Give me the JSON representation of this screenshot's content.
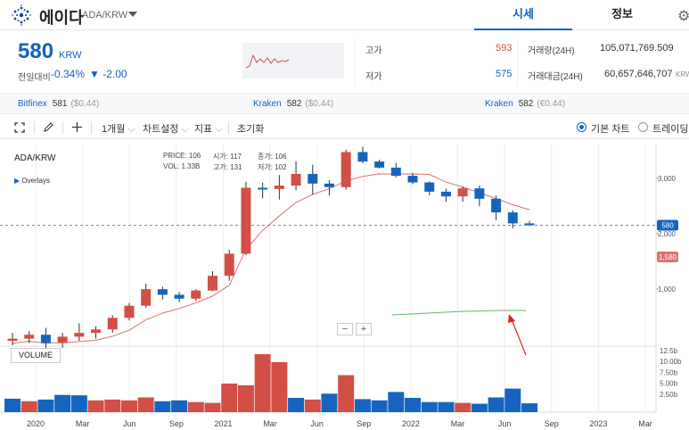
{
  "header": {
    "coin_name": "에이다",
    "pair": "ADA/KRW",
    "tabs": [
      "시세",
      "정보"
    ],
    "settings_icon": "gear-icon"
  },
  "price": {
    "current": "580",
    "unit": "KRW",
    "change_label": "전일대비",
    "change_pct": "-0.34%",
    "change_abs": "▼ -2.00"
  },
  "stats": {
    "high_label": "고가",
    "high": "593",
    "low_label": "저가",
    "low": "575",
    "volume_label": "거래량(24H)",
    "volume": "105,071,769.509",
    "value_label": "거래대금(24H)",
    "value": "60,657,646,707",
    "value_unit": "KRW"
  },
  "exchanges": [
    {
      "name": "Bitfinex",
      "price": "581",
      "sub": "($0.44)"
    },
    {
      "name": "Kraken",
      "price": "582",
      "sub": "($0.44)"
    },
    {
      "name": "Kraken",
      "price": "582",
      "sub": "(€0.44)"
    }
  ],
  "toolbar": {
    "period": "1개월",
    "chart_settings": "차트설정",
    "indicators": "지표",
    "reset": "초기화",
    "basic_chart": "기본 차트",
    "trading_chart": "트레이딩뷰"
  },
  "ohlc_box": {
    "symbol": "ADA/KRW",
    "price_label": "PRICE:",
    "price": "106",
    "open_label": "시가:",
    "open": "117",
    "close_label": "종가:",
    "close": "106",
    "vol_label": "VOL:",
    "vol": "1.33B",
    "high_label": "고가:",
    "high": "131",
    "low_label": "저가:",
    "low": "102",
    "overlays": "Overlays",
    "volume_button": "VOLUME"
  },
  "chart_data": {
    "type": "candlestick",
    "price_axis_labels": [
      "3,000",
      "2,000",
      "1,000"
    ],
    "volume_axis_labels": [
      "12.5b",
      "10.00b",
      "7.50b",
      "5.00b",
      "2.50b"
    ],
    "x_ticks": [
      "2020",
      "Mar",
      "Jun",
      "Sep",
      "2021",
      "Mar",
      "Jun",
      "Sep",
      "2022",
      "Mar",
      "Jun",
      "Sep",
      "2023",
      "Mar"
    ],
    "ma_badge": "1,580",
    "last_badge": "580",
    "colors": {
      "up": "#d24f45",
      "down": "#1565c0",
      "ma_red": "#e07070",
      "ma_green": "#5fb85f"
    },
    "candles": [
      {
        "o": 40,
        "h": 48,
        "l": 36,
        "c": 42
      },
      {
        "o": 42,
        "h": 50,
        "l": 38,
        "c": 46
      },
      {
        "o": 46,
        "h": 54,
        "l": 32,
        "c": 38
      },
      {
        "o": 38,
        "h": 48,
        "l": 34,
        "c": 44
      },
      {
        "o": 44,
        "h": 60,
        "l": 40,
        "c": 48
      },
      {
        "o": 48,
        "h": 56,
        "l": 42,
        "c": 52
      },
      {
        "o": 52,
        "h": 72,
        "l": 48,
        "c": 68
      },
      {
        "o": 68,
        "h": 96,
        "l": 64,
        "c": 90
      },
      {
        "o": 90,
        "h": 150,
        "l": 86,
        "c": 132
      },
      {
        "o": 132,
        "h": 140,
        "l": 104,
        "c": 116
      },
      {
        "o": 116,
        "h": 124,
        "l": 98,
        "c": 106
      },
      {
        "o": 106,
        "h": 132,
        "l": 100,
        "c": 128
      },
      {
        "o": 128,
        "h": 200,
        "l": 126,
        "c": 180
      },
      {
        "o": 180,
        "h": 330,
        "l": 160,
        "c": 300
      },
      {
        "o": 300,
        "h": 1580,
        "l": 290,
        "c": 1380
      },
      {
        "o": 1380,
        "h": 1560,
        "l": 1080,
        "c": 1340
      },
      {
        "o": 1340,
        "h": 1850,
        "l": 1050,
        "c": 1450
      },
      {
        "o": 1450,
        "h": 2550,
        "l": 1300,
        "c": 1900
      },
      {
        "o": 1900,
        "h": 2350,
        "l": 1180,
        "c": 1520
      },
      {
        "o": 1520,
        "h": 1640,
        "l": 1150,
        "c": 1400
      },
      {
        "o": 1400,
        "h": 3330,
        "l": 1320,
        "c": 3150
      },
      {
        "o": 3150,
        "h": 3560,
        "l": 2440,
        "c": 2530
      },
      {
        "o": 2530,
        "h": 2640,
        "l": 2150,
        "c": 2200
      },
      {
        "o": 2200,
        "h": 2450,
        "l": 1750,
        "c": 1820
      },
      {
        "o": 1820,
        "h": 1950,
        "l": 1500,
        "c": 1560
      },
      {
        "o": 1560,
        "h": 1600,
        "l": 1160,
        "c": 1260
      },
      {
        "o": 1260,
        "h": 1350,
        "l": 1000,
        "c": 1130
      },
      {
        "o": 1130,
        "h": 1420,
        "l": 1000,
        "c": 1360
      },
      {
        "o": 1360,
        "h": 1460,
        "l": 900,
        "c": 1070
      },
      {
        "o": 1070,
        "h": 1150,
        "l": 650,
        "c": 780
      },
      {
        "o": 780,
        "h": 820,
        "l": 540,
        "c": 605
      },
      {
        "o": 605,
        "h": 640,
        "l": 570,
        "c": 580
      }
    ],
    "volumes": [
      3.2,
      2.6,
      3.0,
      4.1,
      4.0,
      2.8,
      3.0,
      2.8,
      3.5,
      2.6,
      2.8,
      2.4,
      2.2,
      6.8,
      6.4,
      13.8,
      11.9,
      3.4,
      3.0,
      4.4,
      8.8,
      3.1,
      2.8,
      4.8,
      3.4,
      2.4,
      2.4,
      2.2,
      2.0,
      3.5,
      5.6,
      2.1
    ],
    "vol_up": [
      false,
      true,
      false,
      false,
      false,
      true,
      true,
      true,
      true,
      false,
      false,
      true,
      true,
      true,
      true,
      true,
      true,
      false,
      true,
      false,
      true,
      false,
      false,
      false,
      false,
      false,
      false,
      true,
      false,
      false,
      false,
      false
    ]
  }
}
